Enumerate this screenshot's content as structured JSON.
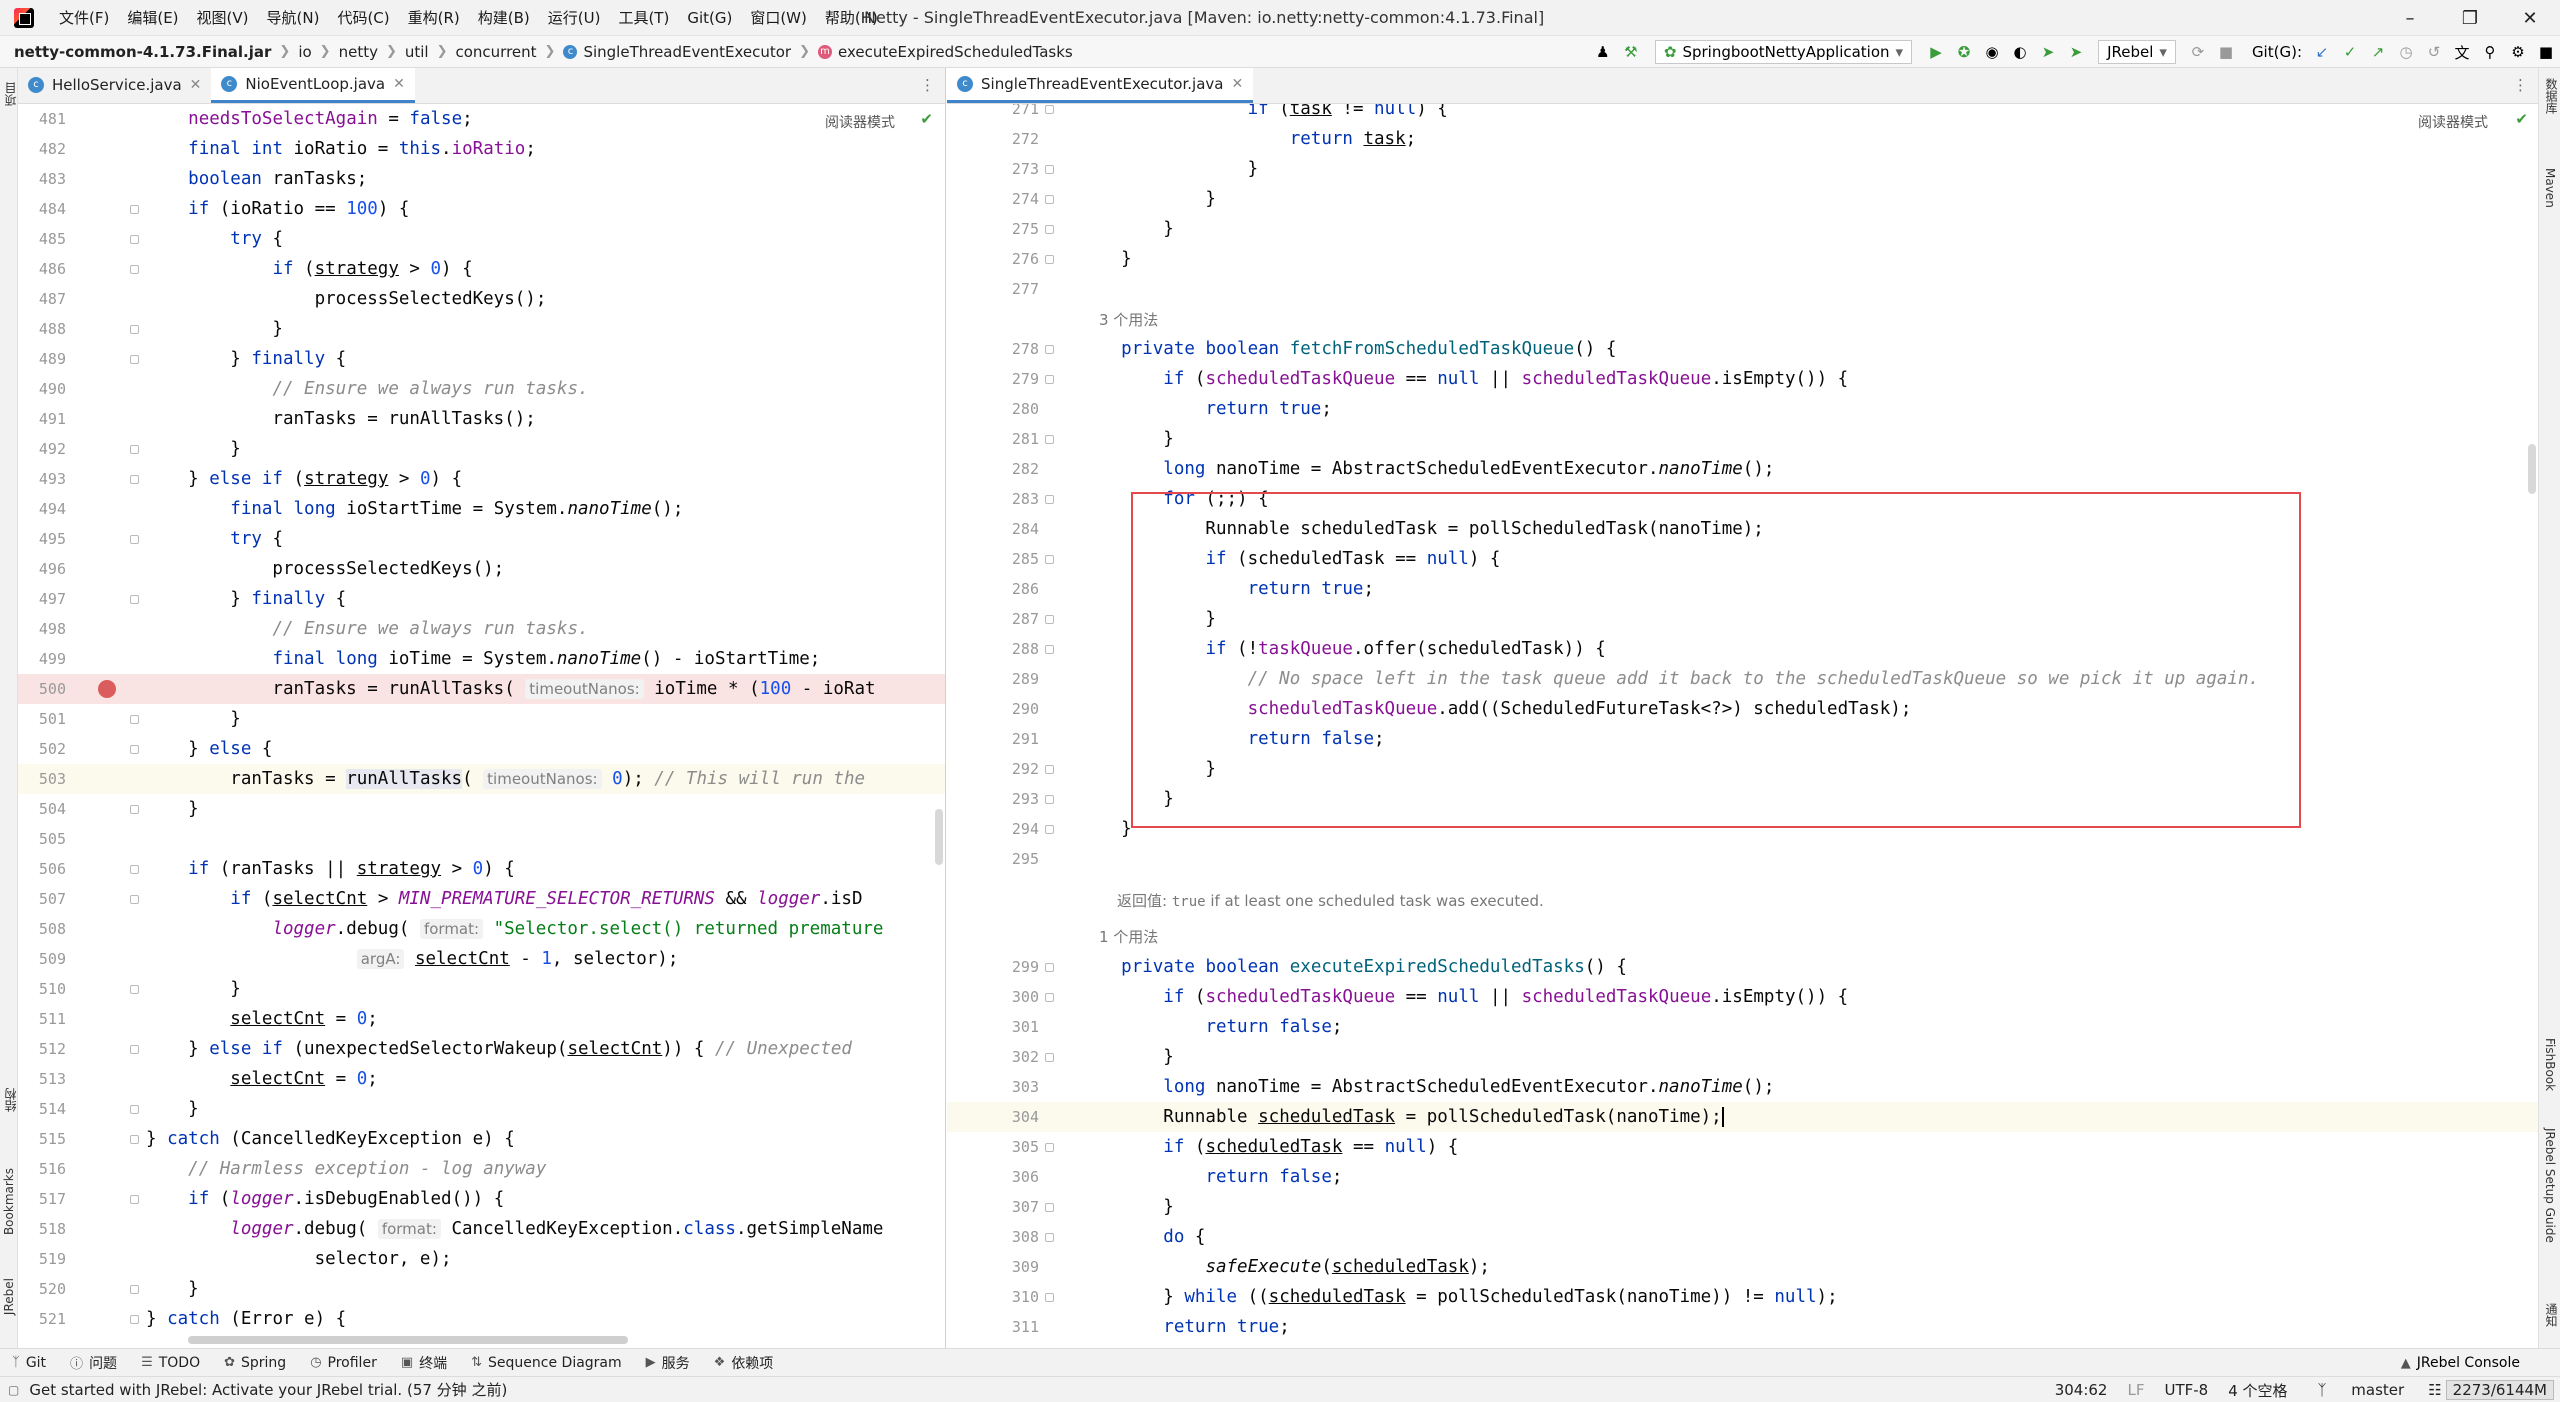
{
  "menubar": {
    "items": [
      "文件(F)",
      "编辑(E)",
      "视图(V)",
      "导航(N)",
      "代码(C)",
      "重构(R)",
      "构建(B)",
      "运行(U)",
      "工具(T)",
      "Git(G)",
      "窗口(W)",
      "帮助(H)"
    ],
    "window_title": "Netty - SingleThreadEventExecutor.java [Maven: io.netty:netty-common:4.1.73.Final]"
  },
  "breadcrumb": {
    "jar": "netty-common-4.1.73.Final.jar",
    "parts": [
      "io",
      "netty",
      "util",
      "concurrent"
    ],
    "class_name": "SingleThreadEventExecutor",
    "method_name": "executeExpiredScheduledTasks"
  },
  "toolbar": {
    "run_config": "SpringbootNettyApplication",
    "jrebel": "JRebel",
    "git_label": "Git(G):"
  },
  "left_strip": {
    "project": "项目",
    "structure": "结构",
    "bookmarks": "Bookmarks",
    "jrebel": "JRebel"
  },
  "right_strip": {
    "database": "数据库",
    "maven": "Maven",
    "fishbook": "FishBook",
    "jrebel_setup": "JRebel Setup Guide",
    "notifications": "通知"
  },
  "left_editor": {
    "tabs": [
      {
        "label": "HelloService.java",
        "active": false
      },
      {
        "label": "NioEventLoop.java",
        "active": true
      }
    ],
    "reader_mode": "阅读器模式",
    "line_numbers": [
      "481",
      "482",
      "483",
      "484",
      "485",
      "486",
      "487",
      "488",
      "489",
      "490",
      "491",
      "492",
      "493",
      "494",
      "495",
      "496",
      "497",
      "498",
      "499",
      "500",
      "501",
      "502",
      "503",
      "504",
      "505",
      "506",
      "507",
      "508",
      "509",
      "510",
      "511",
      "512",
      "513",
      "514",
      "515",
      "516",
      "517",
      "518",
      "519",
      "520",
      "521"
    ]
  },
  "right_editor": {
    "tabs": [
      {
        "label": "SingleThreadEventExecutor.java",
        "active": true
      }
    ],
    "reader_mode": "阅读器模式",
    "usages_1": "3 个用法",
    "doc_returns_label": "返回值:",
    "doc_returns_code": "true",
    "doc_returns_text": " if at least one scheduled task was executed.",
    "usages_2": "1 个用法",
    "line_numbers": [
      "271",
      "272",
      "273",
      "274",
      "275",
      "276",
      "277",
      "278",
      "279",
      "280",
      "281",
      "282",
      "283",
      "284",
      "285",
      "286",
      "287",
      "288",
      "289",
      "290",
      "291",
      "292",
      "293",
      "294",
      "295",
      "299",
      "300",
      "301",
      "302",
      "303",
      "304",
      "305",
      "306",
      "307",
      "308",
      "309",
      "310",
      "311"
    ]
  },
  "bottom_tools": {
    "items": [
      "Git",
      "问题",
      "TODO",
      "Spring",
      "Profiler",
      "终端",
      "Sequence Diagram",
      "服务",
      "依赖项"
    ],
    "right": "JRebel Console"
  },
  "statusbar": {
    "message": "Get started with JRebel: Activate your JRebel trial. (57 分钟 之前)",
    "position": "304:62",
    "line_sep": "LF",
    "encoding": "UTF-8",
    "indent": "4 个空格",
    "branch": "master",
    "memory": "2273/6144M"
  }
}
